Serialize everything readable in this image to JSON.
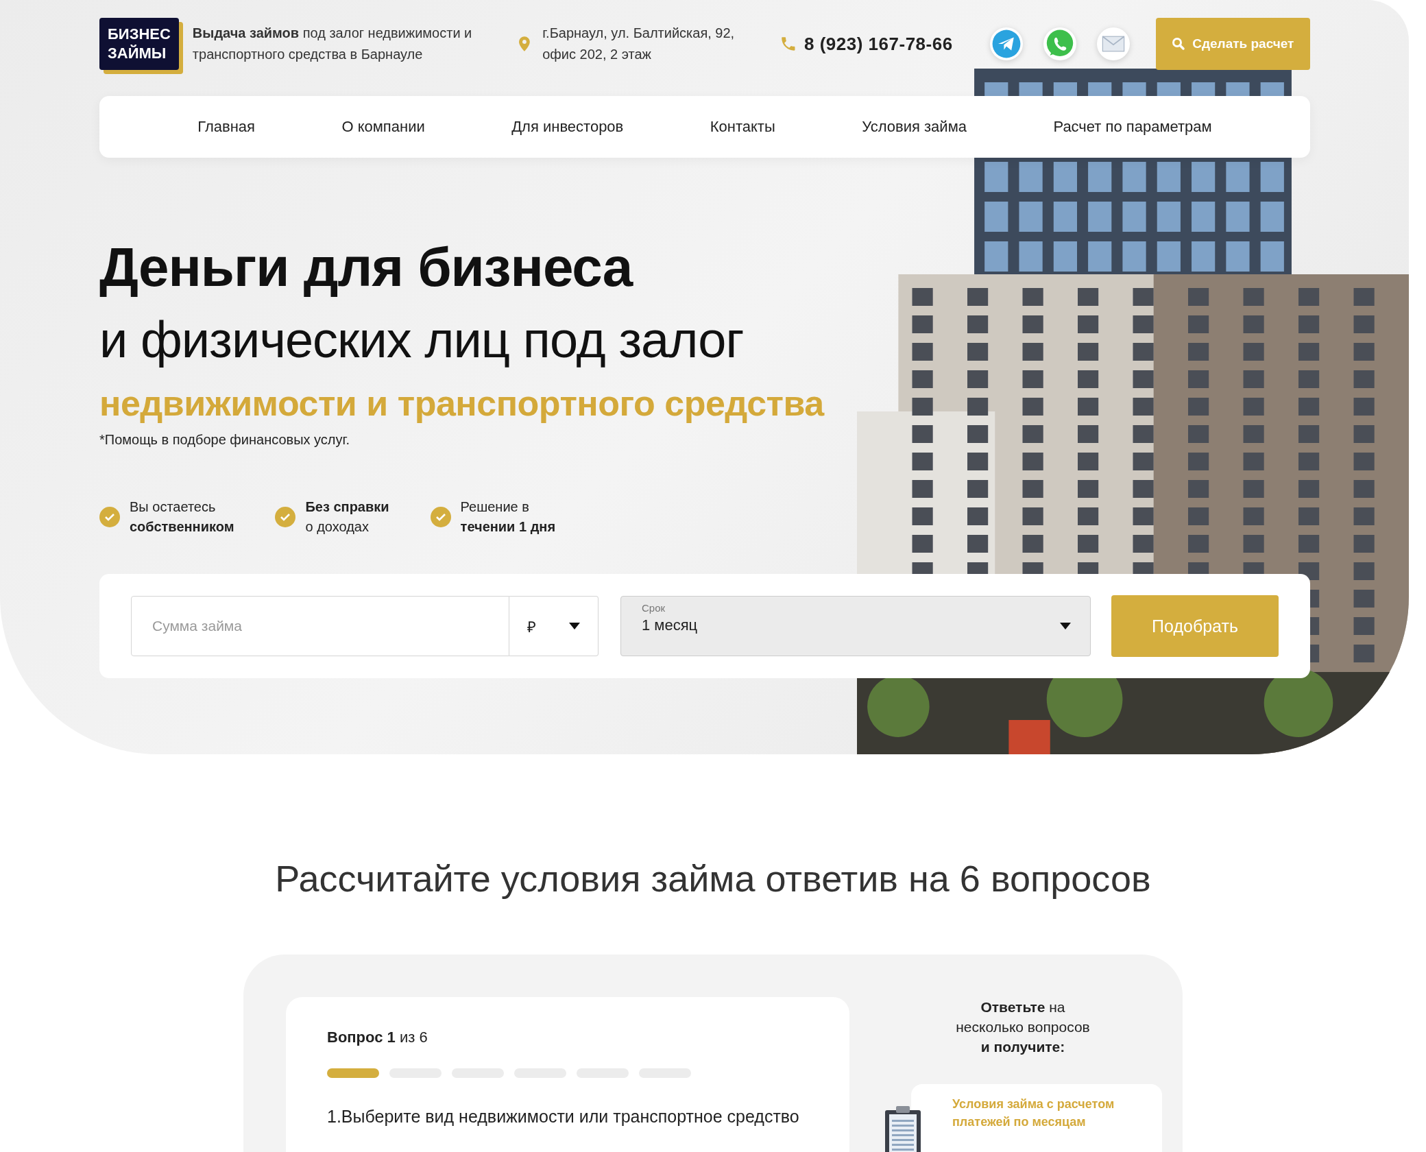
{
  "header": {
    "logo": {
      "line1": "БИЗНЕС",
      "line2": "ЗАЙМЫ"
    },
    "tagline": "**Выдача займов** под залог недвижимости и транспортного средства в Барнауле",
    "address": "г.Барнаул, ул. Балтийская, 92, офис 202, 2 этаж",
    "phone": "8 (923) 167-78-66",
    "messengers": [
      {
        "kind": "telegram"
      },
      {
        "kind": "whatsapp"
      },
      {
        "kind": "email"
      }
    ],
    "cta": "Сделать расчет"
  },
  "nav": {
    "items": [
      {
        "label": "Главная"
      },
      {
        "label": "О компании"
      },
      {
        "label": "Для инвесторов"
      },
      {
        "label": "Контакты"
      },
      {
        "label": "Условия займа"
      },
      {
        "label": "Расчет по параметрам"
      }
    ]
  },
  "hero": {
    "title_bold": "Деньги для бизнеса",
    "title_light": "и физических лиц под залог",
    "title_accent": "недвижимости и транспортного средства",
    "note": "*Помощь в подборе финансовых услуг.",
    "features": [
      {
        "lines": [
          "Вы остаетесь",
          "**собственником**"
        ]
      },
      {
        "lines": [
          "**Без справки**",
          "о доходах"
        ]
      },
      {
        "lines": [
          "Решение в",
          "**течении 1 дня**"
        ]
      }
    ]
  },
  "search": {
    "amount": {
      "placeholder": "Сумма займа"
    },
    "currency": "₽",
    "term": {
      "label": "Срок",
      "value": "1 месяц"
    },
    "button": "Подобрать"
  },
  "quiz": {
    "heading": "Рассчитайте условия займа ответив на 6 вопросов",
    "counter": "**Вопрос 1** из 6",
    "steps": [
      {
        "active": true
      },
      {
        "active": false
      },
      {
        "active": false
      },
      {
        "active": false
      },
      {
        "active": false
      },
      {
        "active": false
      }
    ],
    "question": "1.Выберите вид недвижимости или транспортное средство",
    "side": {
      "lines": [
        "**Ответьте** на",
        "несколько вопросов",
        "**и получите:**"
      ]
    },
    "benefit": "Условия займа с расчетом платежей по месяцам"
  }
}
